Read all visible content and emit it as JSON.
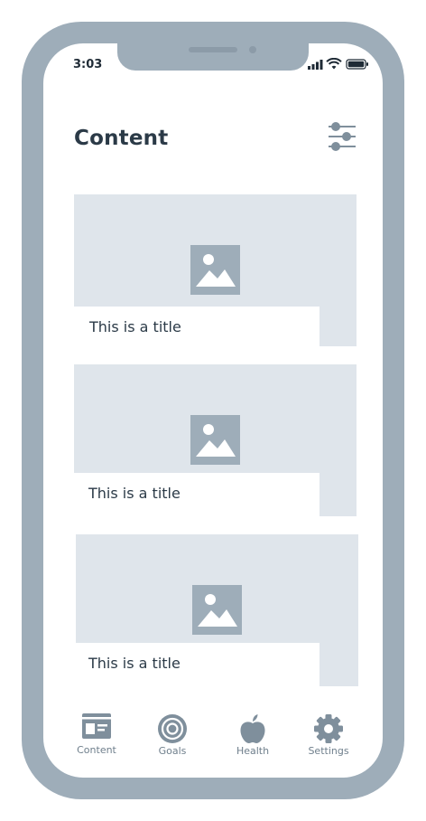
{
  "status_bar": {
    "time": "3:03"
  },
  "header": {
    "title": "Content"
  },
  "cards": [
    {
      "title": "This is a title"
    },
    {
      "title": "This is a title"
    },
    {
      "title": "This is a title"
    }
  ],
  "tab_bar": {
    "tabs": [
      {
        "label": "Content",
        "icon": "content-icon"
      },
      {
        "label": "Goals",
        "icon": "target-icon"
      },
      {
        "label": "Health",
        "icon": "apple-icon"
      },
      {
        "label": "Settings",
        "icon": "gear-icon"
      }
    ]
  },
  "colors": {
    "frame": "#9eadb9",
    "placeholder_bg": "#dfe5eb",
    "text_dark": "#2b3a47",
    "tab_label": "#6f7f8c"
  }
}
